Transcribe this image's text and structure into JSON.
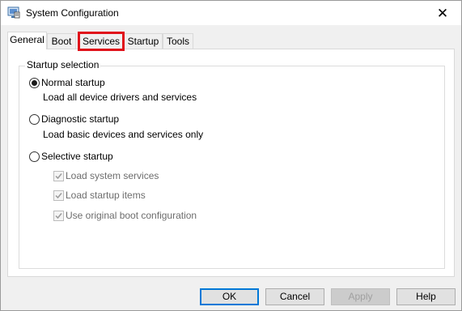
{
  "window": {
    "title": "System Configuration",
    "close_glyph": "✕",
    "icon": "system-config-icon"
  },
  "tabs": [
    {
      "label": "General",
      "active": true
    },
    {
      "label": "Boot",
      "active": false
    },
    {
      "label": "Services",
      "active": false,
      "highlighted": true
    },
    {
      "label": "Startup",
      "active": false
    },
    {
      "label": "Tools",
      "active": false
    }
  ],
  "general": {
    "group_title": "Startup selection",
    "options": [
      {
        "label": "Normal startup",
        "description": "Load all device drivers and services",
        "selected": true
      },
      {
        "label": "Diagnostic startup",
        "description": "Load basic devices and services only",
        "selected": false
      },
      {
        "label": "Selective startup",
        "selected": false
      }
    ],
    "selective_items": [
      {
        "label": "Load system services",
        "checked": true,
        "enabled": false
      },
      {
        "label": "Load startup items",
        "checked": true,
        "enabled": false
      },
      {
        "label": "Use original boot configuration",
        "checked": true,
        "enabled": false
      }
    ]
  },
  "buttons": {
    "ok": "OK",
    "cancel": "Cancel",
    "apply": "Apply",
    "help": "Help"
  },
  "colors": {
    "highlight_box": "#e0101a",
    "default_button_border": "#0078d7"
  }
}
